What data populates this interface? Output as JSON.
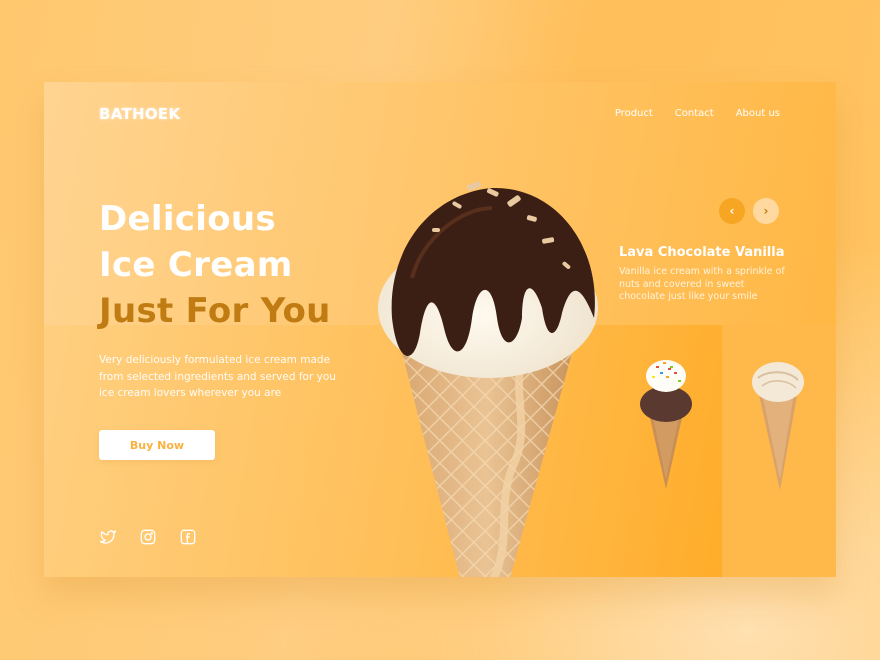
{
  "brand": {
    "logo": "BATHOEK"
  },
  "nav": {
    "items": [
      "Product",
      "Contact",
      "About us"
    ]
  },
  "hero": {
    "title_line1": "Delicious",
    "title_line2": "Ice Cream",
    "title_line3": "Just For You",
    "description": "Very deliciously formulated ice cream made from selected ingredients and served for you ice cream lovers wherever you are",
    "cta_label": "Buy Now"
  },
  "social": {
    "icons": [
      "twitter-icon",
      "instagram-icon",
      "facebook-icon"
    ]
  },
  "carousel": {
    "prev_label": "‹",
    "next_label": "›",
    "product_name": "Lava Chocolate Vanilla",
    "product_description": "Vanilla ice cream with a sprinkle of nuts and covered in sweet chocolate just like your smile"
  },
  "colors": {
    "accent": "#c07c12",
    "button_text": "#fbb040",
    "prev_arrow": "#f6a623",
    "next_arrow": "#ffd9a0"
  }
}
